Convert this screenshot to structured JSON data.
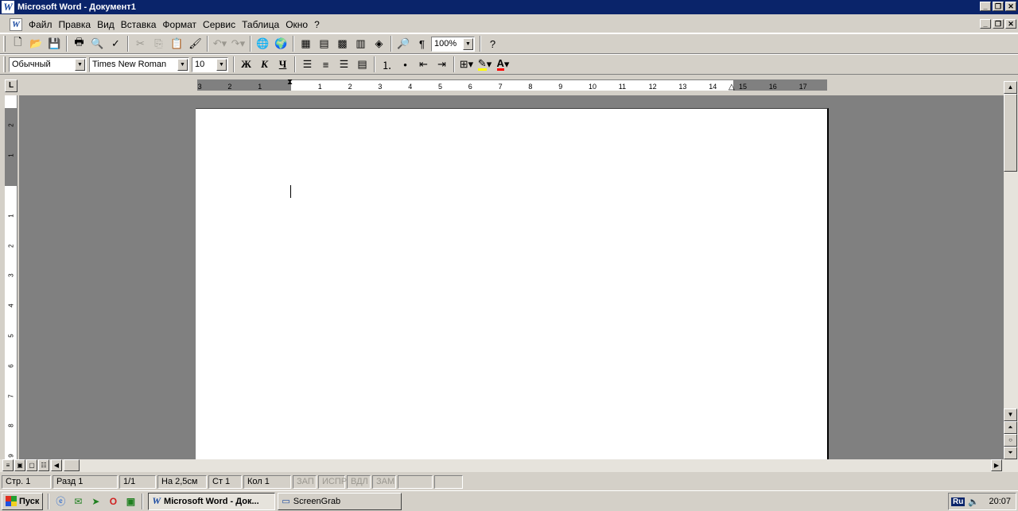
{
  "window": {
    "title": "Microsoft Word - Документ1",
    "app_icon_letter": "W"
  },
  "menu": {
    "items": [
      "Файл",
      "Правка",
      "Вид",
      "Вставка",
      "Формат",
      "Сервис",
      "Таблица",
      "Окно",
      "?"
    ]
  },
  "standard_toolbar": {
    "zoom": "100%"
  },
  "formatting_toolbar": {
    "style": "Обычный",
    "font": "Times New Roman",
    "size": "10",
    "bold": "Ж",
    "italic": "К",
    "underline": "Ч",
    "font_color_letter": "A",
    "colors": {
      "highlight": "#ffff00",
      "font_color": "#ff0000"
    }
  },
  "ruler": {
    "tab_selector": "L",
    "ticks": [
      "3",
      "2",
      "1",
      "1",
      "2",
      "3",
      "4",
      "5",
      "6",
      "7",
      "8",
      "9",
      "10",
      "11",
      "12",
      "13",
      "14",
      "15",
      "16",
      "17"
    ],
    "vticks": [
      "2",
      "1",
      "1",
      "2",
      "3",
      "4",
      "5",
      "6",
      "7",
      "8",
      "9"
    ]
  },
  "status": {
    "page": "Стр. 1",
    "section": "Разд 1",
    "pages": "1/1",
    "at": "На 2,5см",
    "line": "Ст 1",
    "col": "Кол 1",
    "rec": "ЗАП",
    "trk": "ИСПР",
    "ext": "ВДЛ",
    "ovr": "ЗАМ"
  },
  "taskbar": {
    "start": "Пуск",
    "tasks": [
      "Microsoft Word - Док...",
      "ScreenGrab"
    ],
    "lang": "Ru",
    "clock": "20:07"
  }
}
